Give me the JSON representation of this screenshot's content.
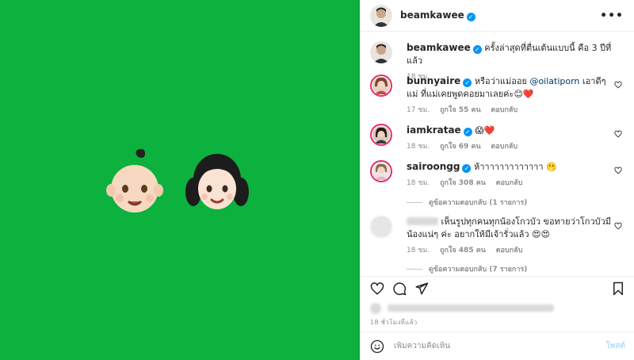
{
  "media": {
    "background": "#0db13e"
  },
  "header": {
    "username": "beamkawee",
    "more_label": "•••"
  },
  "caption": {
    "username": "beamkawee",
    "text": "ครั้งล่าสุดที่ตื่นเต้นแบบนี้ คือ 3 ปีที่แล้ว",
    "time": "18 ชม."
  },
  "comments": [
    {
      "username": "bunnyaire",
      "text_before": "หรือว่าแม่ออย ",
      "mention": "@oilatiporn",
      "text_after": " เอาดีๆแม่ ที่แม่เคยพูดคอยมาเลยค่ะ😊❤️",
      "time": "17 ชม.",
      "likes": "ถูกใจ 55 คน",
      "reply": "ตอบกลับ"
    },
    {
      "username": "iamkratae",
      "text": "😱❤️",
      "time": "18 ชม.",
      "likes": "ถูกใจ 69 คน",
      "reply": "ตอบกลับ"
    },
    {
      "username": "sairoongg",
      "text": "ห้าาาาาาาาาาาาา 🫢",
      "time": "18 ชม.",
      "likes": "ถูกใจ 308 คน",
      "reply": "ตอบกลับ",
      "view_replies": "ดูข้อความตอบกลับ (1 รายการ)"
    },
    {
      "text": "เห็นรูปทุกคนทุกน้องโกวบัว ขอทายว่าโกวบัวมีน้องแน่ๆ ค่ะ อยากให้มีเจ้ารั่วแล้ว 😍😍",
      "time": "18 ชม.",
      "likes": "ถูกใจ 485 คน",
      "reply": "ตอบกลับ",
      "view_replies": "ดูข้อความตอบกลับ (7 รายการ)"
    }
  ],
  "footer": {
    "time": "18 ชั่วโมงที่แล้ว",
    "comment_placeholder": "เพิ่มความคิดเห็น",
    "post_label": "โพสต์"
  }
}
